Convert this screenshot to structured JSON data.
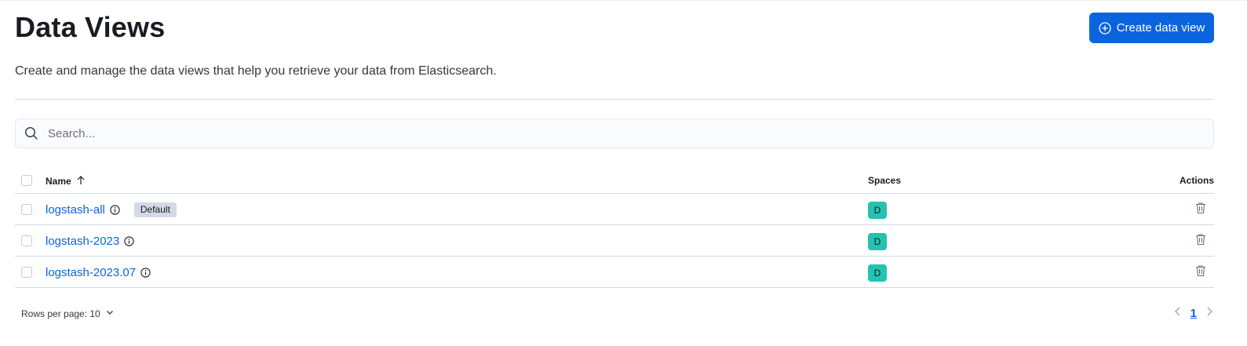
{
  "header": {
    "title": "Data Views",
    "create_button_label": "Create data view",
    "description": "Create and manage the data views that help you retrieve your data from Elasticsearch."
  },
  "search": {
    "placeholder": "Search...",
    "value": ""
  },
  "table": {
    "columns": {
      "name": "Name",
      "spaces": "Spaces",
      "actions": "Actions"
    },
    "sort": {
      "column": "Name",
      "direction": "ascending"
    },
    "rows": [
      {
        "name": "logstash-all",
        "badge": "Default",
        "space": "D"
      },
      {
        "name": "logstash-2023",
        "badge": "",
        "space": "D"
      },
      {
        "name": "logstash-2023.07",
        "badge": "",
        "space": "D"
      }
    ]
  },
  "footer": {
    "rows_per_page": "Rows per page: 10",
    "current_page": "1"
  },
  "colors": {
    "primary": "#0b64dd",
    "space_avatar": "#24c2b0",
    "badge": "#d3dae6"
  }
}
